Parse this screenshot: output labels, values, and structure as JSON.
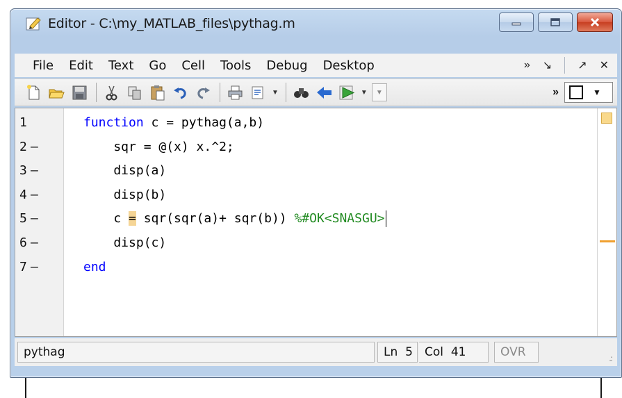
{
  "window": {
    "title": "Editor - C:\\my_MATLAB_files\\pythag.m",
    "controls": [
      "minimize",
      "maximize",
      "close"
    ]
  },
  "menu": {
    "items": [
      "File",
      "Edit",
      "Text",
      "Go",
      "Cell",
      "Tools",
      "Debug",
      "Desktop"
    ],
    "overflow": "»",
    "dock": "↘",
    "undock": "↗",
    "close": "✕"
  },
  "toolbar": {
    "icons": [
      "new-file-icon",
      "open-folder-icon",
      "save-icon",
      "cut-icon",
      "copy-icon",
      "paste-icon",
      "undo-icon",
      "redo-icon",
      "print-icon",
      "publish-icon",
      "find-icon",
      "back-icon",
      "run-icon"
    ],
    "overflow": "»"
  },
  "editor": {
    "lines": [
      {
        "num": "1",
        "dash": "",
        "tokens": [
          {
            "t": "function",
            "c": "kw"
          },
          {
            "t": " c = pythag(a,b)",
            "c": ""
          }
        ]
      },
      {
        "num": "2",
        "dash": "—",
        "tokens": [
          {
            "t": "    sqr = @(x) x.^2;",
            "c": ""
          }
        ]
      },
      {
        "num": "3",
        "dash": "—",
        "tokens": [
          {
            "t": "    disp(a)",
            "c": ""
          }
        ]
      },
      {
        "num": "4",
        "dash": "—",
        "tokens": [
          {
            "t": "    disp(b)",
            "c": ""
          }
        ]
      },
      {
        "num": "5",
        "dash": "—",
        "tokens": [
          {
            "t": "    c ",
            "c": ""
          },
          {
            "t": "=",
            "c": "hl"
          },
          {
            "t": " sqr(sqr(a)+ sqr(b)) ",
            "c": ""
          },
          {
            "t": "%#OK<SNASGU>",
            "c": "cm"
          }
        ]
      },
      {
        "num": "6",
        "dash": "—",
        "tokens": [
          {
            "t": "    disp(c)",
            "c": ""
          }
        ]
      },
      {
        "num": "7",
        "dash": "—",
        "tokens": [
          {
            "t": "end",
            "c": "kw"
          }
        ]
      }
    ],
    "cursor_line": 5
  },
  "statusbar": {
    "function": "pythag",
    "ln_label": "Ln",
    "ln_value": "5",
    "col_label": "Col",
    "col_value": "41",
    "ovr": "OVR"
  },
  "colors": {
    "keyword": "#0000ff",
    "comment": "#228b22",
    "highlight": "#f5d596",
    "warning": "#f0a030"
  }
}
